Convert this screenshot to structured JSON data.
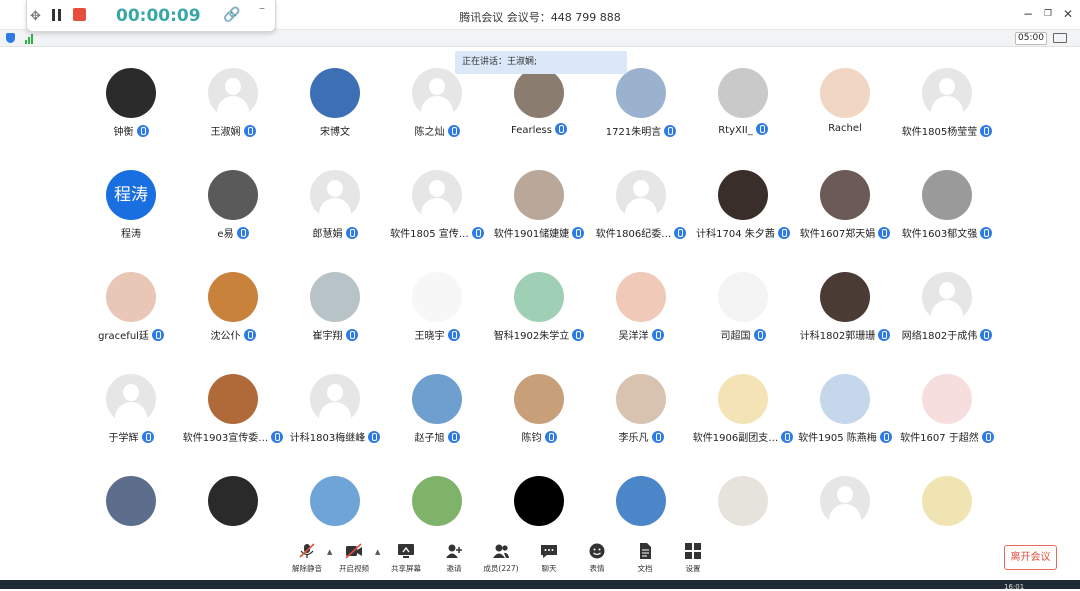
{
  "window": {
    "title": "腾讯会议 会议号：448 799 888",
    "minimize": "−",
    "restore": "❐",
    "close": "✕"
  },
  "recording": {
    "timer": "00:00:09"
  },
  "status": {
    "duration": "05:00"
  },
  "speaking": {
    "text": "正在讲话：王淑娴;"
  },
  "participants": [
    {
      "name": "钟衡",
      "mic": true,
      "avatar": "#2b2b2b"
    },
    {
      "name": "王淑娴",
      "mic": true,
      "avatar": "default"
    },
    {
      "name": "宋博文",
      "mic": false,
      "avatar": "#3d6fb5"
    },
    {
      "name": "陈之灿",
      "mic": true,
      "avatar": "default"
    },
    {
      "name": "Fearless",
      "mic": true,
      "avatar": "#8a7d70"
    },
    {
      "name": "1721朱明言",
      "mic": true,
      "avatar": "#9bb2cf"
    },
    {
      "name": "RtyXII_",
      "mic": true,
      "avatar": "#c9c9c9"
    },
    {
      "name": "Rachel",
      "mic": false,
      "avatar": "#f2d6c4"
    },
    {
      "name": "软件1805杨莹莹",
      "mic": true,
      "avatar": "default"
    },
    {
      "name": "程涛",
      "mic": false,
      "avatar": "text",
      "initials": "程涛"
    },
    {
      "name": "e易",
      "mic": true,
      "avatar": "#5a5a5a"
    },
    {
      "name": "郎慧娟",
      "mic": true,
      "avatar": "default"
    },
    {
      "name": "软件1805 宣传…",
      "mic": true,
      "avatar": "default"
    },
    {
      "name": "软件1901储婕婕",
      "mic": true,
      "avatar": "#b9a89a"
    },
    {
      "name": "软件1806纪委…",
      "mic": true,
      "avatar": "default"
    },
    {
      "name": "计科1704 朱夕茜",
      "mic": true,
      "avatar": "#3a2e2a"
    },
    {
      "name": "软件1607郑天娟",
      "mic": true,
      "avatar": "#6b5a55"
    },
    {
      "name": "软件1603郁文强",
      "mic": true,
      "avatar": "#9a9a9a"
    },
    {
      "name": "graceful廷",
      "mic": true,
      "avatar": "#e9c7b6"
    },
    {
      "name": "沈公仆",
      "mic": true,
      "avatar": "#c8823c"
    },
    {
      "name": "崔宇翔",
      "mic": true,
      "avatar": "#b8c3c7"
    },
    {
      "name": "王晓宇",
      "mic": true,
      "avatar": "#f7f7f7"
    },
    {
      "name": "智科1902朱学立",
      "mic": true,
      "avatar": "#9fd0b5"
    },
    {
      "name": "吴洋洋",
      "mic": true,
      "avatar": "#f0c9b8"
    },
    {
      "name": "司超国",
      "mic": true,
      "avatar": "#f4f4f4"
    },
    {
      "name": "计科1802郭珊珊",
      "mic": true,
      "avatar": "#4a3b35"
    },
    {
      "name": "网络1802于成伟",
      "mic": true,
      "avatar": "default"
    },
    {
      "name": "于学辉",
      "mic": true,
      "avatar": "default"
    },
    {
      "name": "软件1903宣传委…",
      "mic": true,
      "avatar": "#b06a3a"
    },
    {
      "name": "计科1803梅继峰",
      "mic": true,
      "avatar": "default"
    },
    {
      "name": "赵子旭",
      "mic": true,
      "avatar": "#6f9fcf"
    },
    {
      "name": "陈钧",
      "mic": true,
      "avatar": "#c7a079"
    },
    {
      "name": "李乐凡",
      "mic": true,
      "avatar": "#d7c3b0"
    },
    {
      "name": "软件1906副团支…",
      "mic": true,
      "avatar": "#f3e3b5"
    },
    {
      "name": "软件1905 陈燕梅",
      "mic": true,
      "avatar": "#c5d7ea"
    },
    {
      "name": "软件1607 于超然",
      "mic": true,
      "avatar": "#f7dede"
    },
    {
      "name": "",
      "mic": false,
      "avatar": "#5d6d8c"
    },
    {
      "name": "",
      "mic": false,
      "avatar": "#2a2a2a"
    },
    {
      "name": "",
      "mic": false,
      "avatar": "#6fa5d6"
    },
    {
      "name": "",
      "mic": false,
      "avatar": "#7fb36a"
    },
    {
      "name": "",
      "mic": false,
      "avatar": "#000000"
    },
    {
      "name": "",
      "mic": false,
      "avatar": "#4a86c8"
    },
    {
      "name": "",
      "mic": false,
      "avatar": "#e6e2dc"
    },
    {
      "name": "",
      "mic": false,
      "avatar": "default"
    },
    {
      "name": "",
      "mic": false,
      "avatar": "#f1e4b3"
    }
  ],
  "toolbar": {
    "unmute": "解除静音",
    "video": "开启视频",
    "share": "共享屏幕",
    "invite": "邀请",
    "members": "成员(227)",
    "chat": "聊天",
    "emoji": "表情",
    "docs": "文档",
    "apps": "设置",
    "leave": "离开会议"
  },
  "taskbar": {
    "clock": "16:01"
  }
}
